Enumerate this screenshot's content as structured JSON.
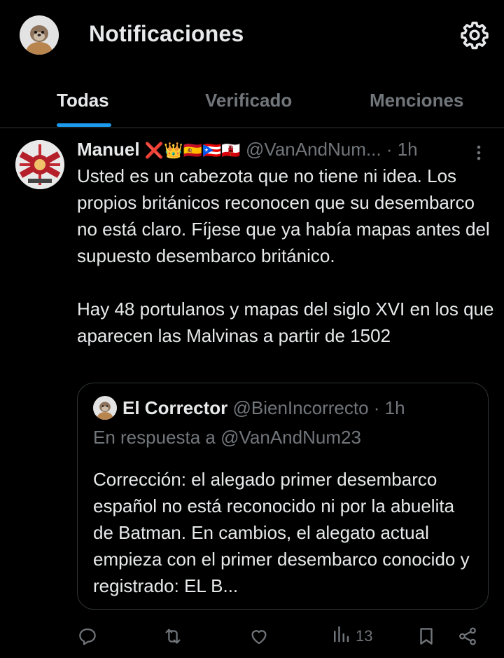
{
  "header": {
    "title": "Notificaciones",
    "avatar_icon": "otter-avatar",
    "settings_icon": "gear-icon"
  },
  "tabs": [
    {
      "label": "Todas",
      "active": true
    },
    {
      "label": "Verificado",
      "active": false
    },
    {
      "label": "Menciones",
      "active": false
    }
  ],
  "post": {
    "name": "Manuel",
    "emojis": "❌👑🇪🇸🇵🇷🇬🇮",
    "handle": "@VanAndNum...",
    "time": "· 1h",
    "paragraphs": [
      "Usted es un cabezota que no tiene ni idea. Los propios británicos reconocen que su desembarco no está claro. Fíjese que ya había mapas antes del supuesto desembarco británico.",
      "Hay 48 portulanos y mapas del siglo XVI en los que aparecen las Malvinas a partir de 1502"
    ],
    "quote": {
      "name": "El Corrector",
      "handle": "@BienIncorrecto",
      "time": "· 1h",
      "reply_to": "En respuesta a @VanAndNum23",
      "body": "Corrección: el alegado primer desembarco español no está reconocido ni por la abuelita de Batman. En cambios, el alegato actual empieza con el primer desembarco conocido y registrado: EL B..."
    },
    "actions": {
      "reply_icon": "reply-icon",
      "retweet_icon": "retweet-icon",
      "like_icon": "heart-icon",
      "views_icon": "views-icon",
      "views_count": "13",
      "bookmark_icon": "bookmark-icon",
      "share_icon": "share-icon"
    }
  },
  "colors": {
    "background": "#000000",
    "text": "#e7e9ea",
    "muted": "#71767b",
    "accent": "#1d9bf0",
    "border": "#2f3336"
  }
}
